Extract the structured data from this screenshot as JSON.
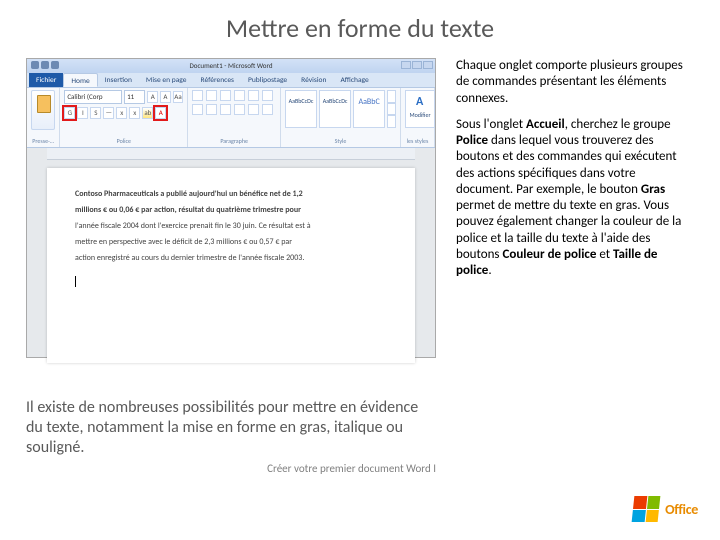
{
  "slide": {
    "title": "Mettre en forme du texte",
    "caption": "Il existe de nombreuses possibilités pour mettre en évidence du texte, notamment la mise en forme en gras, italique ou souligné.",
    "footer": "Créer votre premier document Word I"
  },
  "right_text": {
    "p1": "Chaque onglet comporte plusieurs groupes de commandes présentant les éléments connexes.",
    "p2_a": "Sous l'onglet ",
    "p2_b": "Accueil",
    "p2_c": ", cherchez le groupe ",
    "p2_d": "Police",
    "p2_e": " dans lequel vous trouverez des boutons et des commandes qui exécutent des actions spécifiques dans votre document. Par exemple, le bouton ",
    "p2_f": "Gras",
    "p2_g": " permet de mettre du texte en gras. Vous pouvez également changer la couleur de la police et la taille du texte à l'aide des boutons ",
    "p2_h": "Couleur de police",
    "p2_i": " et ",
    "p2_j": "Taille de police",
    "p2_k": "."
  },
  "word_mock": {
    "titlebar": "Document1 - Microsoft Word",
    "tabs": {
      "file": "Fichier",
      "home": "Home",
      "insert": "Insertion",
      "layout": "Mise en page",
      "references": "Références",
      "mailings": "Publipostage",
      "review": "Révision",
      "view": "Affichage"
    },
    "groups": {
      "clipboard": "Presse-…",
      "font": "Police",
      "paragraph": "Paragraphe",
      "styles": "Style",
      "editing": "les styles"
    },
    "font": {
      "name": "Calibri (Corp",
      "size": "11",
      "bold": "G",
      "italic": "I",
      "underline": "S",
      "strike": "abc",
      "sub": "x₂",
      "sup": "x²",
      "color": "A"
    },
    "styles": {
      "s1": "AaBbCcDc",
      "s2": "AaBbCcDc",
      "s3": "AaBbC"
    },
    "editing_btn": "Modifier",
    "document": {
      "l1": "Contoso Pharmaceuticals a publié aujourd'hui un bénéfice net de 1,2",
      "l2": "millions € ou 0,06 € par action, résultat du quatrième trimestre pour",
      "l3": "l'année fiscale 2004 dont l'exercice prenait fin le 30 juin. Ce résultat est à",
      "l4": "mettre en perspective avec le déficit de 2,3 millions € ou 0,57 € par",
      "l5": "action enregistré au cours du dernier trimestre de l'année fiscale 2003."
    }
  },
  "logo": {
    "text": "Office"
  }
}
